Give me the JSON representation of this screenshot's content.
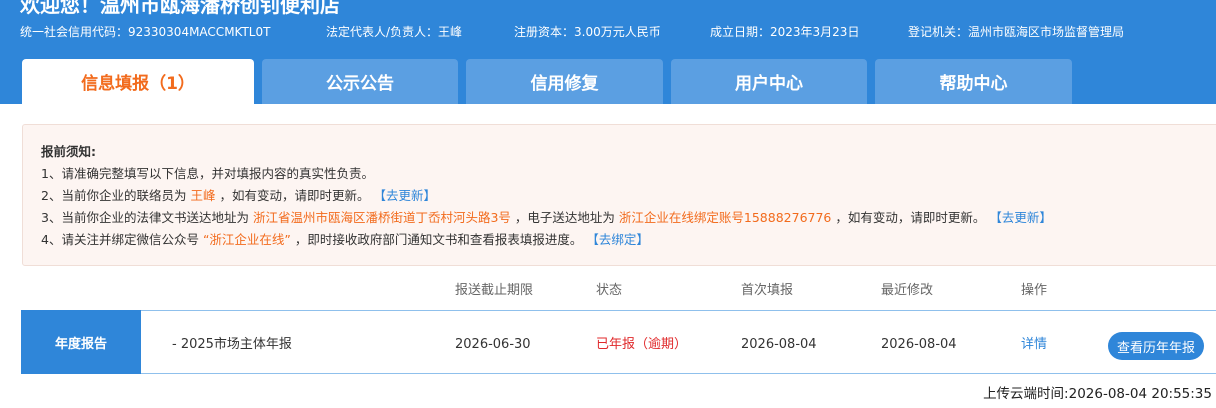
{
  "header": {
    "welcome": "欢迎您！温州市瓯海潘桥创钊便利店",
    "credit_code": "统一社会信用代码：92330304MACCMKTL0T",
    "legal_rep": "法定代表人/负责人：王峰",
    "capital": "注册资本：3.00万元人民币",
    "founded": "成立日期：2023年3月23日",
    "authority": "登记机关：温州市瓯海区市场监督管理局"
  },
  "tabs": [
    {
      "label": "信息填报（1）",
      "active": true
    },
    {
      "label": "公示公告",
      "active": false
    },
    {
      "label": "信用修复",
      "active": false
    },
    {
      "label": "用户中心",
      "active": false
    },
    {
      "label": "帮助中心",
      "active": false
    }
  ],
  "notice": {
    "title": "报前须知:",
    "line1": "1、请准确完整填写以下信息，并对填报内容的真实性负责。",
    "line2_prefix": "2、当前你企业的联络员为",
    "line2_name": "王峰",
    "line2_suffix": "，如有变动，请即时更新。",
    "line2_link": "【去更新】",
    "line3_prefix": "3、当前你企业的法律文书送达地址为",
    "line3_address": "浙江省温州市瓯海区潘桥街道丁岙村河头路3号",
    "line3_mid": "，电子送达地址为",
    "line3_email": "浙江企业在线绑定账号15888276776",
    "line3_suffix": "，如有变动，请即时更新。",
    "line3_link": "【去更新】",
    "line4_prefix": "4、请关注并绑定微信公众号",
    "line4_account": "“浙江企业在线”",
    "line4_suffix": "，即时接收政府部门通知文书和查看报表填报进度。",
    "line4_link": "【去绑定】"
  },
  "table": {
    "headers": [
      "报送截止期限",
      "状态",
      "首次填报",
      "最近修改",
      "操作"
    ],
    "row": {
      "label": "年度报告",
      "name": "- 2025市场主体年报",
      "deadline": "2026-06-30",
      "status": "已年报（逾期）",
      "first_filed": "2026-08-04",
      "last_modified": "2026-08-04",
      "detail_link": "详情",
      "history_button": "查看历年年报"
    }
  },
  "footer": {
    "upload_time": "上传云端时间:2026-08-04 20:55:35"
  },
  "colors": {
    "primary": "#2f86d9",
    "tab_inactive": "#5b9fe2",
    "accent_orange": "#f26b1d",
    "status_red": "#e0292b",
    "notice_bg": "#fdf5f2"
  }
}
